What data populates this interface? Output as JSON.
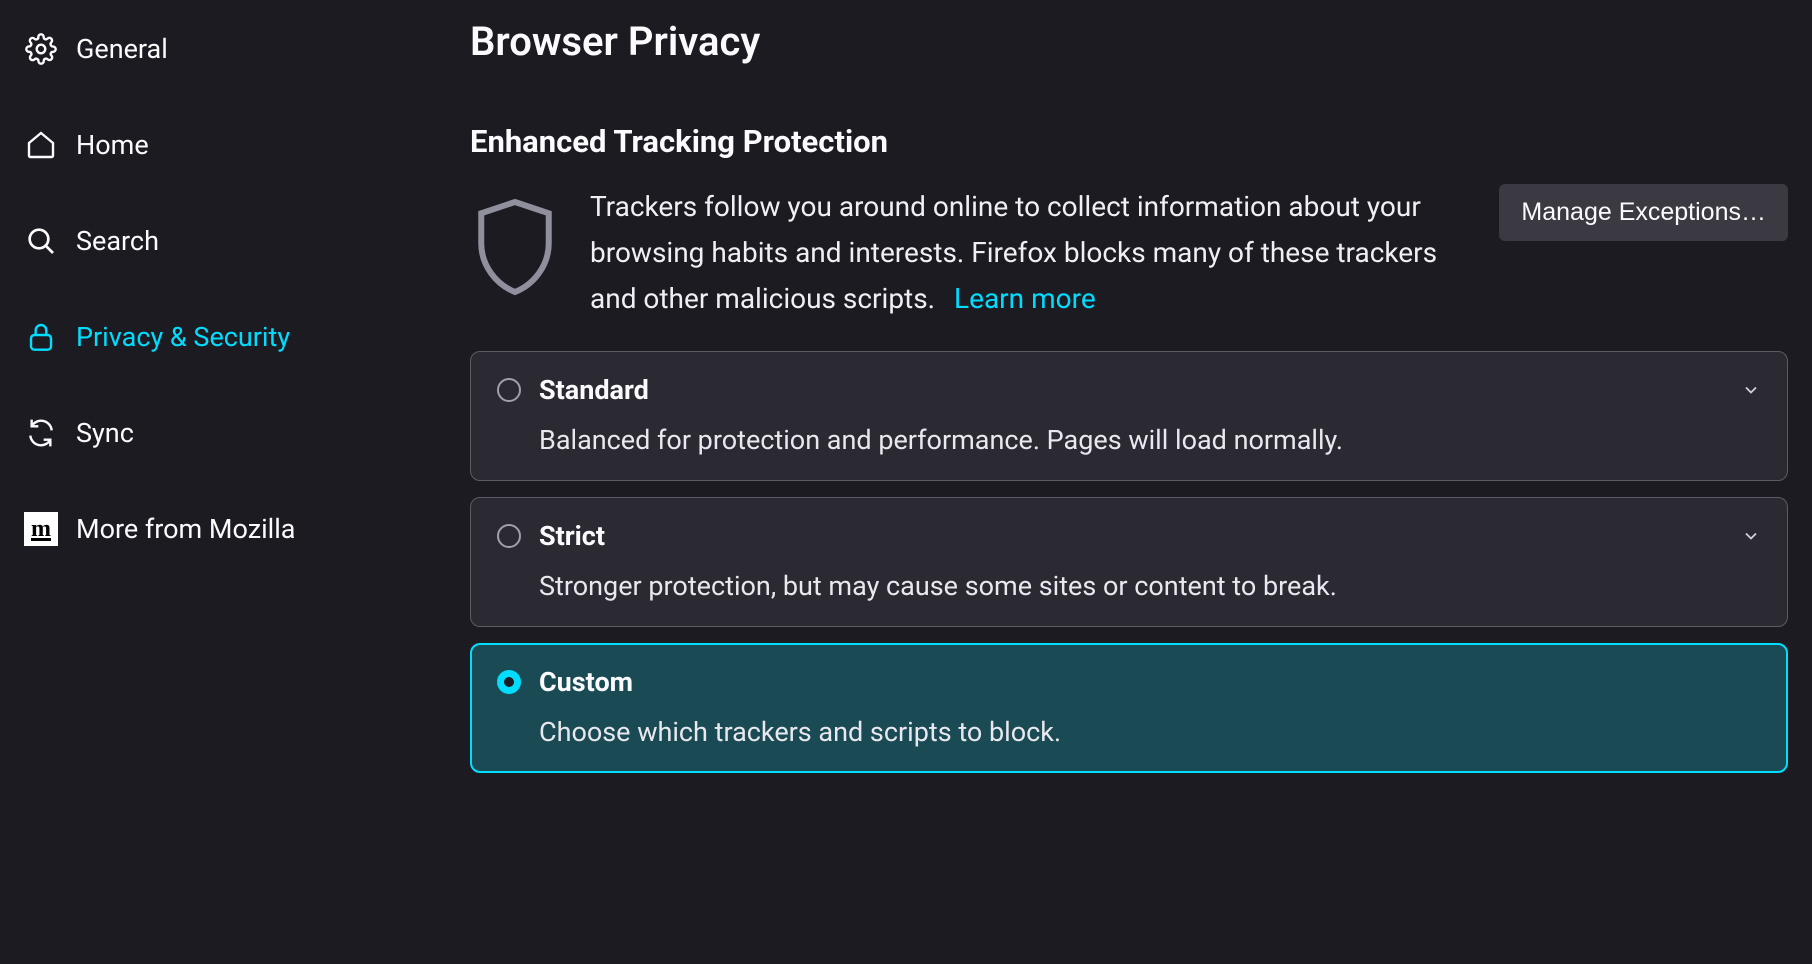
{
  "sidebar": {
    "items": [
      {
        "label": "General"
      },
      {
        "label": "Home"
      },
      {
        "label": "Search"
      },
      {
        "label": "Privacy & Security"
      },
      {
        "label": "Sync"
      },
      {
        "label": "More from Mozilla"
      }
    ]
  },
  "main": {
    "page_title": "Browser Privacy",
    "section_title": "Enhanced Tracking Protection",
    "description": "Trackers follow you around online to collect information about your browsing habits and interests. Firefox blocks many of these trackers and other malicious scripts.",
    "learn_more_label": "Learn more",
    "manage_exceptions_label": "Manage Exceptions…",
    "options": [
      {
        "title": "Standard",
        "desc": "Balanced for protection and performance. Pages will load normally.",
        "selected": false,
        "expandable": true
      },
      {
        "title": "Strict",
        "desc": "Stronger protection, but may cause some sites or content to break.",
        "selected": false,
        "expandable": true
      },
      {
        "title": "Custom",
        "desc": "Choose which trackers and scripts to block.",
        "selected": true,
        "expandable": false
      }
    ]
  },
  "colors": {
    "accent": "#00ddff",
    "bg": "#1c1b22",
    "card": "#2b2a33",
    "selected_card": "#1a4b55"
  }
}
